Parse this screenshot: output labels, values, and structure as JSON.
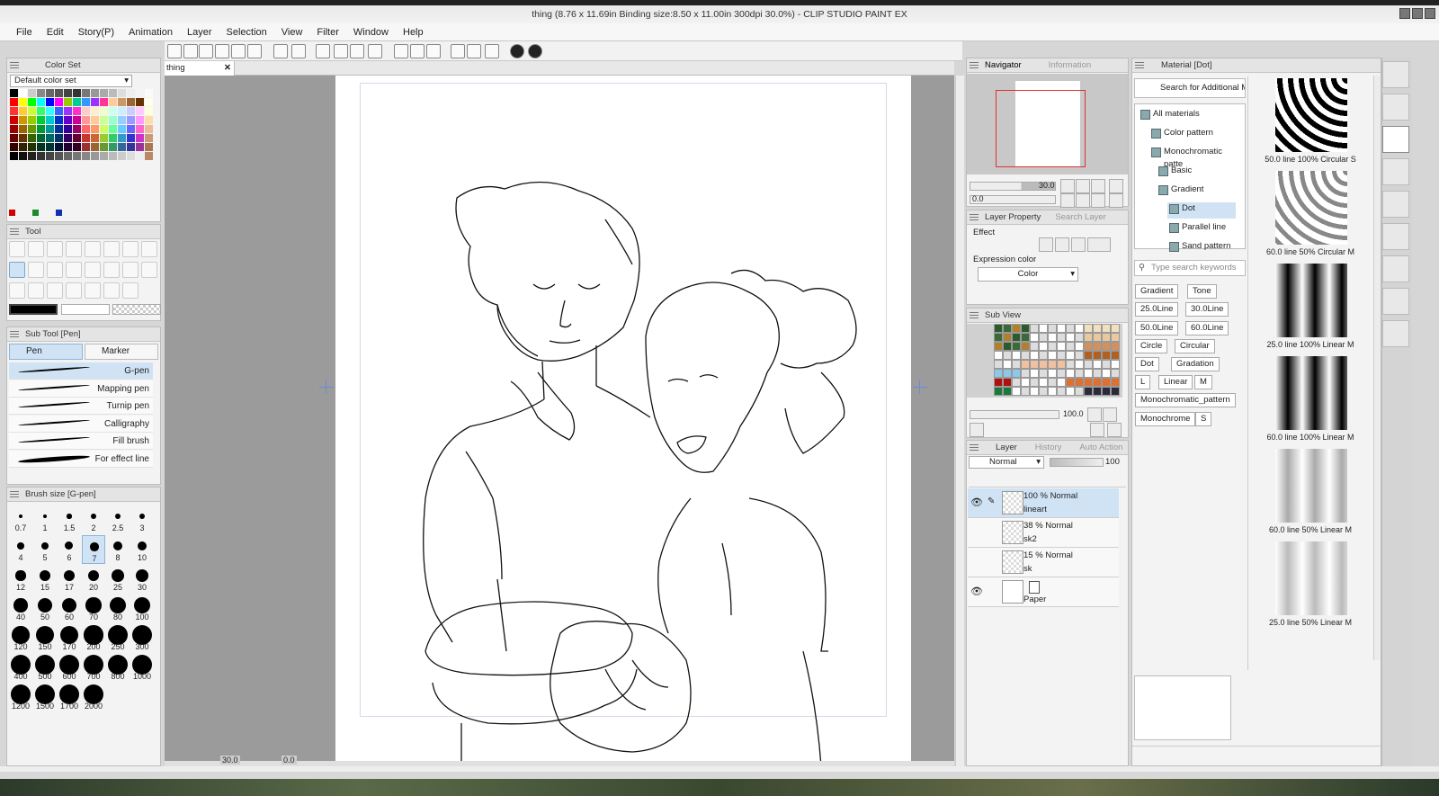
{
  "window": {
    "title": "thing (8.76 x 11.69in Binding size:8.50 x 11.00in 300dpi 30.0%) - CLIP STUDIO PAINT EX"
  },
  "menu": [
    "File",
    "Edit",
    "Story(P)",
    "Animation",
    "Layer",
    "Selection",
    "View",
    "Filter",
    "Window",
    "Help"
  ],
  "color_set": {
    "tab": "Color Set",
    "dropdown": "Default color set"
  },
  "tool_panel": {
    "title": "Tool"
  },
  "subtool": {
    "title": "Sub Tool [Pen]",
    "tabs": [
      "Pen",
      "Marker"
    ],
    "items": [
      "G-pen",
      "Mapping pen",
      "Turnip pen",
      "Calligraphy",
      "Fill brush",
      "For effect line"
    ]
  },
  "brush_size": {
    "title": "Brush size [G-pen]",
    "sizes": [
      "0.7",
      "1",
      "1.5",
      "2",
      "2.5",
      "3",
      "4",
      "5",
      "6",
      "7",
      "8",
      "10",
      "12",
      "15",
      "17",
      "20",
      "25",
      "30",
      "40",
      "50",
      "60",
      "70",
      "80",
      "100",
      "120",
      "150",
      "170",
      "200",
      "250",
      "300",
      "400",
      "500",
      "600",
      "700",
      "800",
      "1000",
      "1200",
      "1500",
      "1700",
      "2000"
    ],
    "selected": "7"
  },
  "canvas": {
    "tab": "thing",
    "zoom": "30.0",
    "angle": "0.0"
  },
  "navigator": {
    "tabs": [
      "Navigator",
      "Information"
    ],
    "zoom": "30.0",
    "angle": "0.0"
  },
  "layer_property": {
    "tabs": [
      "Layer Property",
      "Search Layer"
    ],
    "effect_label": "Effect",
    "expression_label": "Expression color",
    "expression_value": "Color"
  },
  "sub_view": {
    "title": "Sub View",
    "zoom": "100.0"
  },
  "layer_panel": {
    "tabs": [
      "Layer",
      "History",
      "Auto Action"
    ],
    "blend": "Normal",
    "opacity": "100",
    "layers": [
      {
        "mode": "100 % Normal",
        "name": "lineart"
      },
      {
        "mode": "38 % Normal",
        "name": "sk2"
      },
      {
        "mode": "15 % Normal",
        "name": "sk"
      },
      {
        "mode": "",
        "name": "Paper"
      }
    ]
  },
  "material": {
    "title": "Material [Dot]",
    "search_btn": "Search for Additional M...",
    "search_placeholder": "Type search keywords",
    "tree": [
      "All materials",
      "Color pattern",
      "Monochromatic patte",
      "Basic",
      "Gradient",
      "Dot",
      "Parallel line",
      "Sand pattern"
    ],
    "tags": [
      "Gradient",
      "Tone",
      "25.0Line",
      "30.0Line",
      "50.0Line",
      "60.0Line",
      "Circle",
      "Circular",
      "Dot",
      "Gradation",
      "L",
      "Linear",
      "M",
      "Monochromatic_pattern",
      "Monochrome",
      "S"
    ],
    "items": [
      "50.0 line 100% Circular S",
      "60.0 line 50% Circular M",
      "25.0 line 100% Linear M",
      "60.0 line 100% Linear M",
      "60.0 line 50% Linear M",
      "25.0 line 50% Linear M"
    ]
  }
}
